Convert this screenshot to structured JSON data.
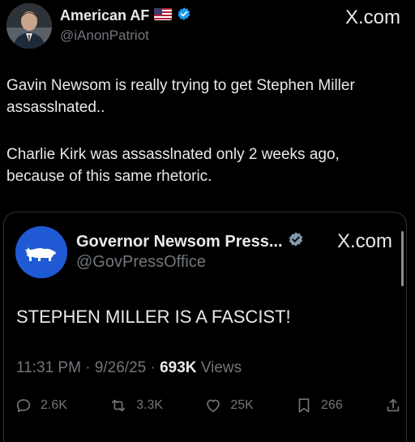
{
  "author": {
    "name": "American AF",
    "flag": "🇺🇸",
    "verified_color": "#1d9bf0",
    "handle": "@iAnonPatriot"
  },
  "brand": {
    "label": "X.com"
  },
  "post": {
    "paragraph_1": "Gavin Newsom is really trying to get Stephen Miller\nassasslnated..",
    "paragraph_2": "Charlie Kirk was assasslnated only 2 weeks ago,\nbecause of this same rhetoric."
  },
  "quote": {
    "name": "Governor Newsom Press...",
    "verified_color": "#829aab",
    "handle": "@GovPressOffice",
    "brand": "X.com",
    "text": "STEPHEN MILLER IS A FASCIST!",
    "avatar_color": "#1f5ad4",
    "time": "11:31 PM",
    "date": "9/26/25",
    "views_count": "693K",
    "views_label": "Views"
  },
  "actions": {
    "replies": "2.6K",
    "reposts": "3.3K",
    "likes": "25K",
    "bookmarks": "266"
  }
}
